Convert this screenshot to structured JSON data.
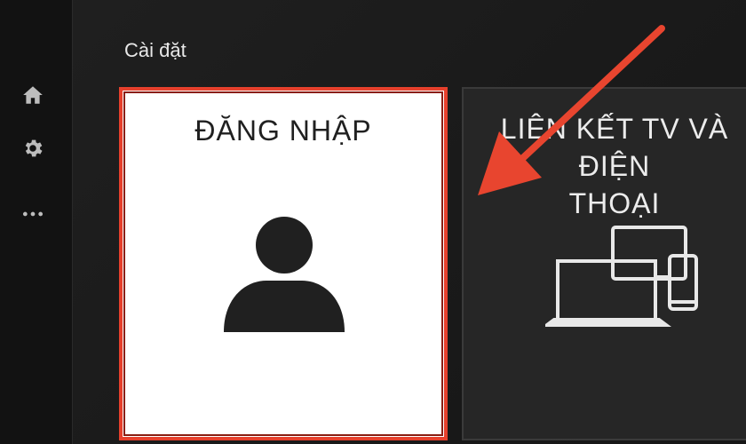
{
  "header": {
    "title": "Cài đặt"
  },
  "sidebar": {
    "items": [
      {
        "icon": "home-icon"
      },
      {
        "icon": "gear-icon"
      },
      {
        "icon": "more-icon"
      }
    ]
  },
  "cards": [
    {
      "title": "ĐĂNG NHẬP",
      "icon": "person-icon",
      "selected": true
    },
    {
      "title": "LIÊN KẾT TV VÀ ĐIỆN\nTHOẠI",
      "icon": "devices-icon",
      "selected": false
    }
  ],
  "colors": {
    "highlight": "#e6402c",
    "annotation_arrow": "#e8452f",
    "background": "#1c1c1c",
    "card_selected_bg": "#ffffff"
  }
}
